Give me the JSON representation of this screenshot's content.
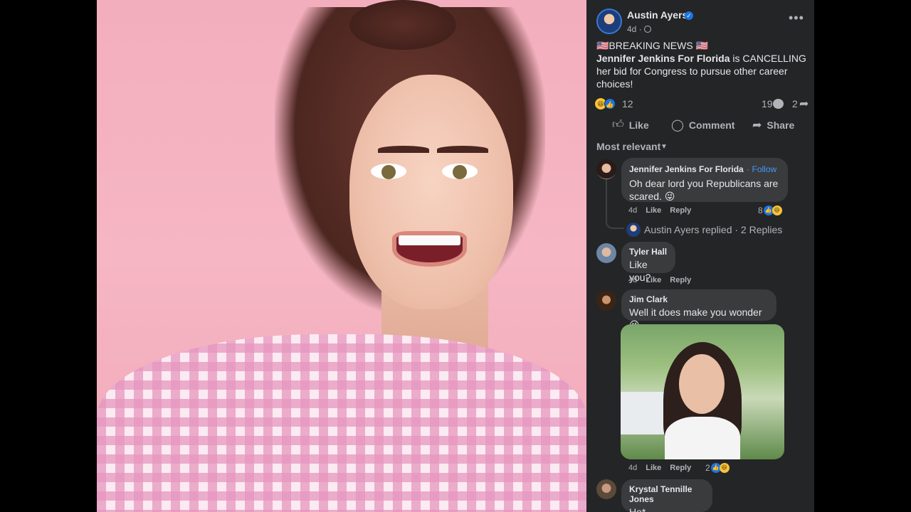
{
  "post": {
    "author": "Austin Ayers",
    "time": "4d ·",
    "more": "•••",
    "headline": "🇺🇸BREAKING NEWS 🇺🇸",
    "mention": "Jennifer Jenkins For Florida",
    "body": " is CANCELLING her bid for Congress to pursue other career choices!",
    "reaction_count": "12",
    "comment_count": "19",
    "share_count": "2"
  },
  "actions": {
    "like": "Like",
    "comment": "Comment",
    "share": "Share"
  },
  "sort": {
    "label": "Most relevant"
  },
  "comments": [
    {
      "name": "Jennifer Jenkins For Florida",
      "follow": "· Follow",
      "text": "Oh dear lord you Republicans are scared. 😜",
      "time": "4d",
      "like": "Like",
      "reply": "Reply",
      "reactions": "8"
    },
    {
      "name": "Tyler Hall",
      "text": "Like you?",
      "time": "4d",
      "like": "Like",
      "reply": "Reply"
    },
    {
      "name": "Jim Clark",
      "text": "Well it does make you wonder😜",
      "time": "4d",
      "like": "Like",
      "reply": "Reply",
      "reactions": "2"
    },
    {
      "name": "Krystal Tennille Jones",
      "text": "He*"
    }
  ],
  "replies": {
    "label": "Austin Ayers replied · 2 Replies"
  },
  "icons": {
    "verified": "✓",
    "like": "👍",
    "comment": "◯",
    "share": "➦",
    "caret": "▼",
    "share_arrow": "➦"
  },
  "colors": {
    "panel": "#242526",
    "bubble": "#3a3b3c",
    "link": "#4599ff",
    "like_blue": "#1b74e4"
  }
}
